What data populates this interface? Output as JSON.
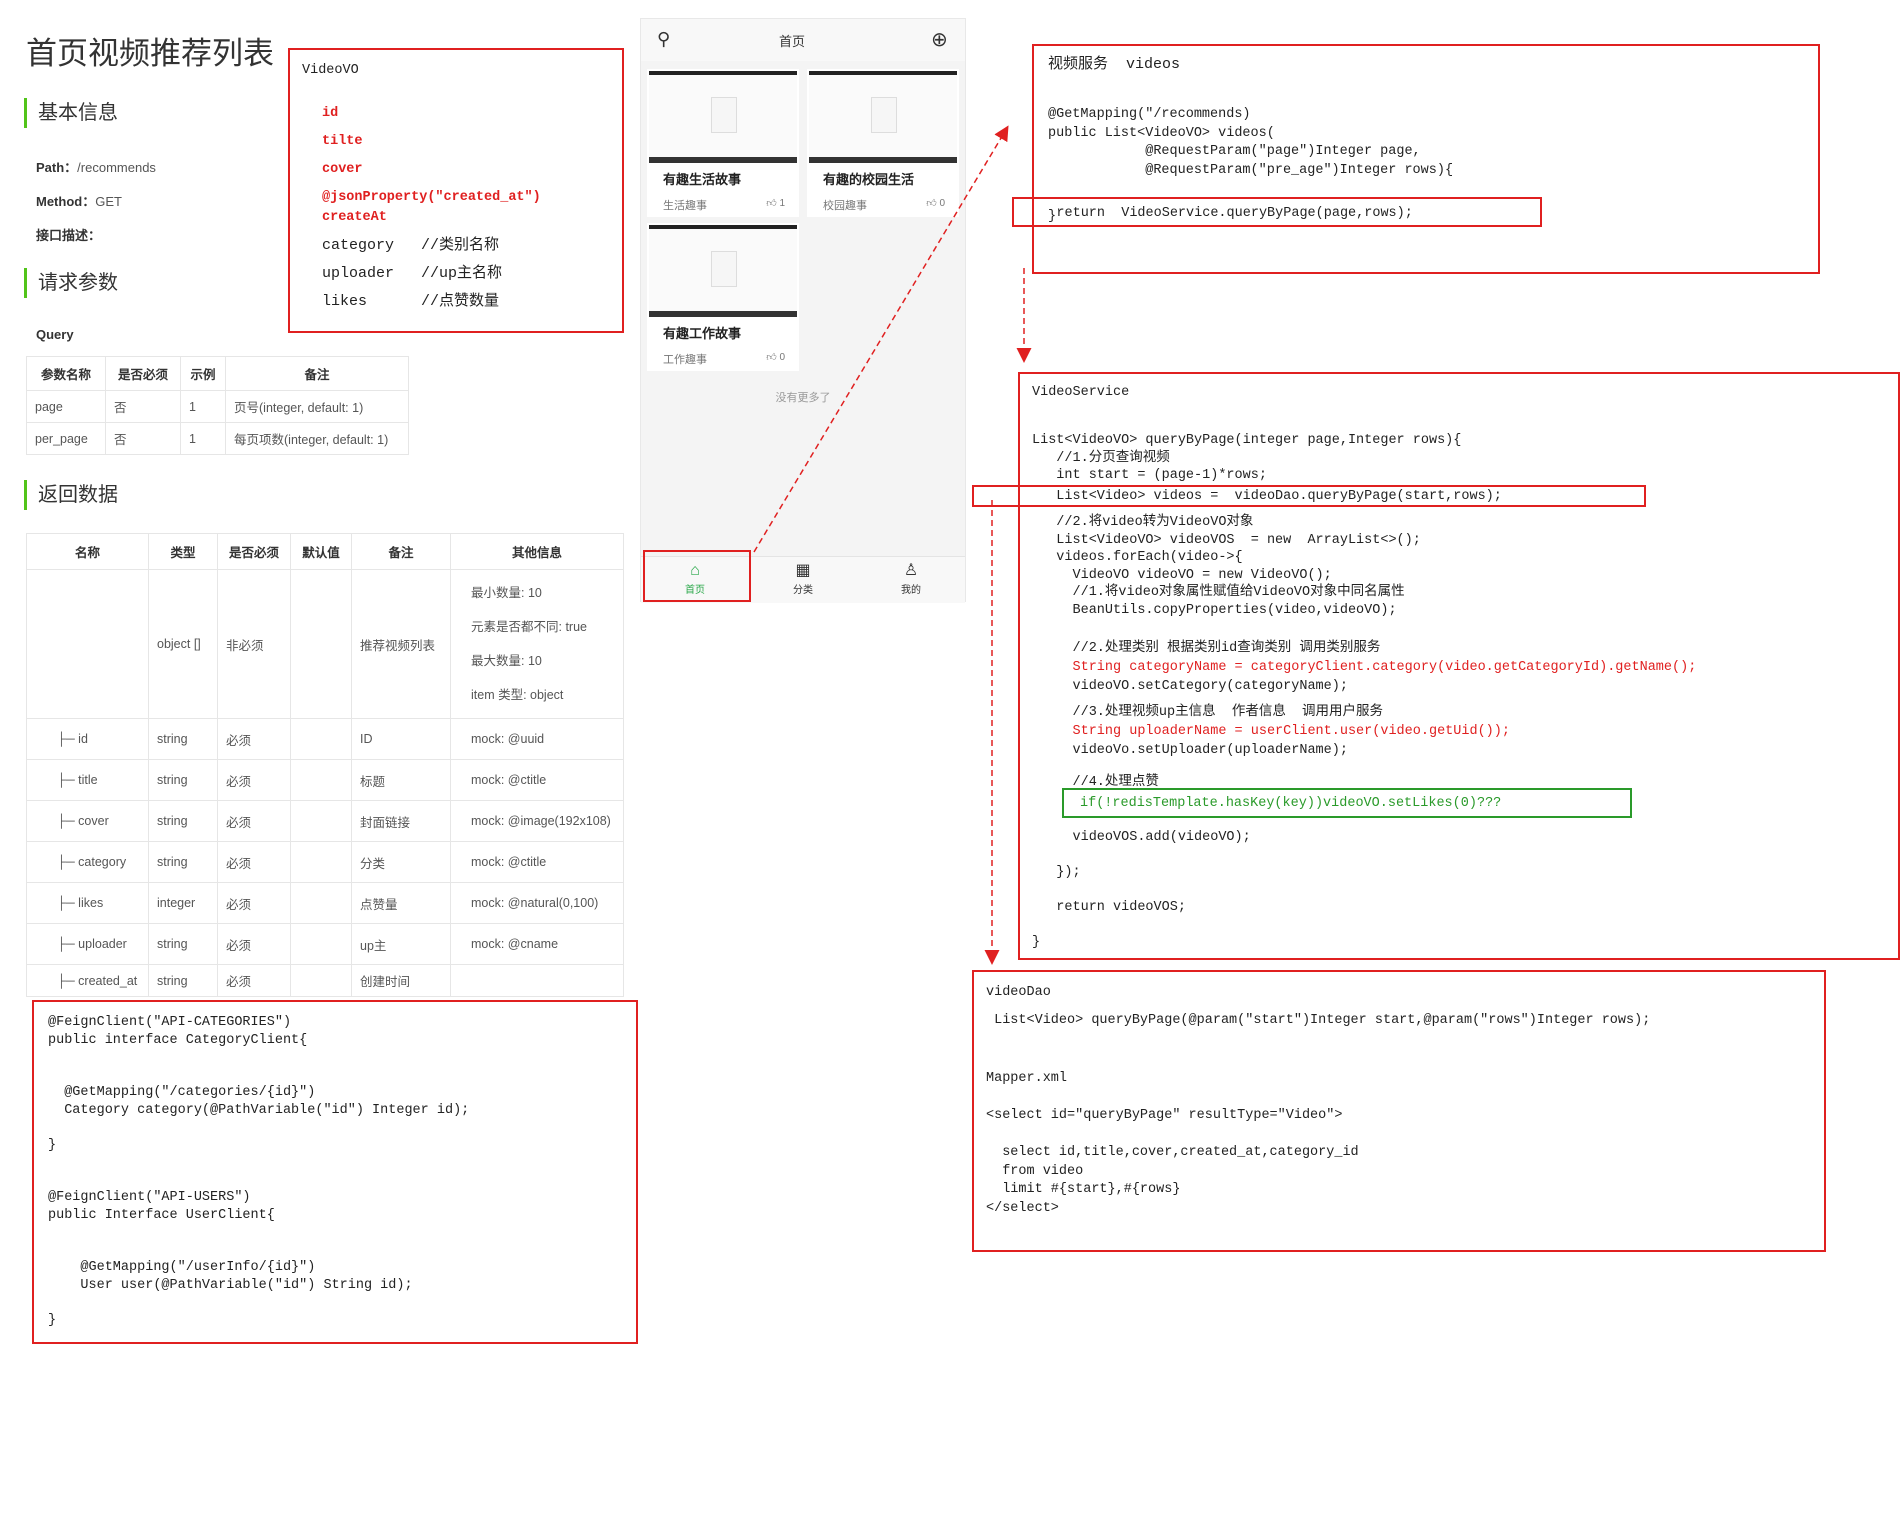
{
  "doc": {
    "title": "首页视频推荐列表",
    "basic_info": "基本信息",
    "path_label": "Path：",
    "path_value": "/recommends",
    "method_label": "Method：",
    "method_value": "GET",
    "desc_label": "接口描述：",
    "request_params": "请求参数",
    "query_label": "Query",
    "query_headers": [
      "参数名称",
      "是否必须",
      "示例",
      "备注"
    ],
    "query_rows": [
      [
        "page",
        "否",
        "1",
        "页号(integer, default: 1)"
      ],
      [
        "per_page",
        "否",
        "1",
        "每页项数(integer, default: 1)"
      ]
    ],
    "return_data": "返回数据",
    "return_headers": [
      "名称",
      "类型",
      "是否必须",
      "默认值",
      "备注",
      "其他信息"
    ],
    "return_root": {
      "type": "object []",
      "required": "非必须",
      "remark": "推荐视频列表",
      "other": [
        "最小数量: 10",
        "元素是否都不同: true",
        "最大数量: 10",
        "item 类型: object"
      ]
    },
    "return_rows": [
      [
        "├─ id",
        "string",
        "必须",
        "",
        "ID",
        "mock: @uuid"
      ],
      [
        "├─ title",
        "string",
        "必须",
        "",
        "标题",
        "mock: @ctitle"
      ],
      [
        "├─ cover",
        "string",
        "必须",
        "",
        "封面链接",
        "mock: @image(192x108)"
      ],
      [
        "├─ category",
        "string",
        "必须",
        "",
        "分类",
        "mock: @ctitle"
      ],
      [
        "├─ likes",
        "integer",
        "必须",
        "",
        "点赞量",
        "mock: @natural(0,100)"
      ],
      [
        "├─ uploader",
        "string",
        "必须",
        "",
        "up主",
        "mock: @cname"
      ],
      [
        "├─ created_at",
        "string",
        "必须",
        "",
        "创建时间",
        ""
      ]
    ]
  },
  "videovo": {
    "title": "VideoVO",
    "fields_red": [
      "id",
      "tilte",
      "cover",
      "@jsonProperty(\"created_at\")",
      "createAt"
    ],
    "fields": [
      "category   //类别名称",
      "uploader   //up主名称",
      "likes      //点赞数量"
    ]
  },
  "phone": {
    "header_title": "首页",
    "cards": [
      {
        "title": "有趣生活故事",
        "category": "生活趣事",
        "likes": "1"
      },
      {
        "title": "有趣的校园生活",
        "category": "校园趣事",
        "likes": "0"
      },
      {
        "title": "有趣工作故事",
        "category": "工作趣事",
        "likes": "0"
      }
    ],
    "no_more": "没有更多了",
    "tabs": [
      "首页",
      "分类",
      "我的"
    ]
  },
  "video_service": {
    "title": "视频服务  videos",
    "code": "@GetMapping(\"/recommends)\npublic List<VideoVO> videos(\n            @RequestParam(\"page\")Integer page,\n            @RequestParam(\"pre_age\")Integer rows){",
    "return_line": "    return  VideoService.queryByPage(page,rows);",
    "close": "}"
  },
  "videoservice": {
    "title": "VideoService",
    "code_a": "List<VideoVO> queryByPage(integer page,Integer rows){\n   //1.分页查询视频\n   int start = (page-1)*rows;",
    "dao_line": "   List<Video> videos =  videoDao.queryByPage(start,rows);",
    "code_b": "   //2.将video转为VideoVO对象\n   List<VideoVO> videoVOS  = new  ArrayList<>();\n   videos.forEach(video->{\n     VideoVO videoVO = new VideoVO();\n     //1.将video对象属性赋值给VideoVO对象中同名属性\n     BeanUtils.copyProperties(video,videoVO);",
    "comment2": "     //2.处理类别 根据类别id查询类别 调用类别服务",
    "red1": "     String categoryName = categoryClient.category(video.getCategoryId).getName();",
    "setcat": "     videoVO.setCategory(categoryName);",
    "comment3": "     //3.处理视频up主信息  作者信息  调用用户服务",
    "red2": "     String uploaderName = userClient.user(video.getUid());",
    "setup": "     videoVo.setUploader(uploaderName);",
    "comment4": "     //4.处理点赞",
    "green_line": "if(!redisTemplate.hasKey(key))videoVO.setLikes(0)???",
    "code_c": "     videoVOS.add(videoVO);\n\n   });\n\n   return videoVOS;\n\n}"
  },
  "videodao": {
    "title": "videoDao",
    "sig": " List<Video> queryByPage(@param(\"start\")Integer start,@param(\"rows\")Integer rows);",
    "mapper": "Mapper.xml\n\n<select id=\"queryByPage\" resultType=\"Video\">\n\n  select id,title,cover,created_at,category_id\n  from video\n  limit #{start},#{rows}\n</select>"
  },
  "feign": {
    "code": "@FeignClient(\"API-CATEGORIES\")\npublic interface CategoryClient{\n\n\n  @GetMapping(\"/categories/{id}\")\n  Category category(@PathVariable(\"id\") Integer id);\n\n}\n\n\n@FeignClient(\"API-USERS\")\npublic Interface UserClient{\n\n\n    @GetMapping(\"/userInfo/{id}\")\n    User user(@PathVariable(\"id\") String id);\n\n}"
  },
  "colors": {
    "red": "#e02020",
    "green": "#2a9a2a",
    "accent": "#52c41a"
  }
}
